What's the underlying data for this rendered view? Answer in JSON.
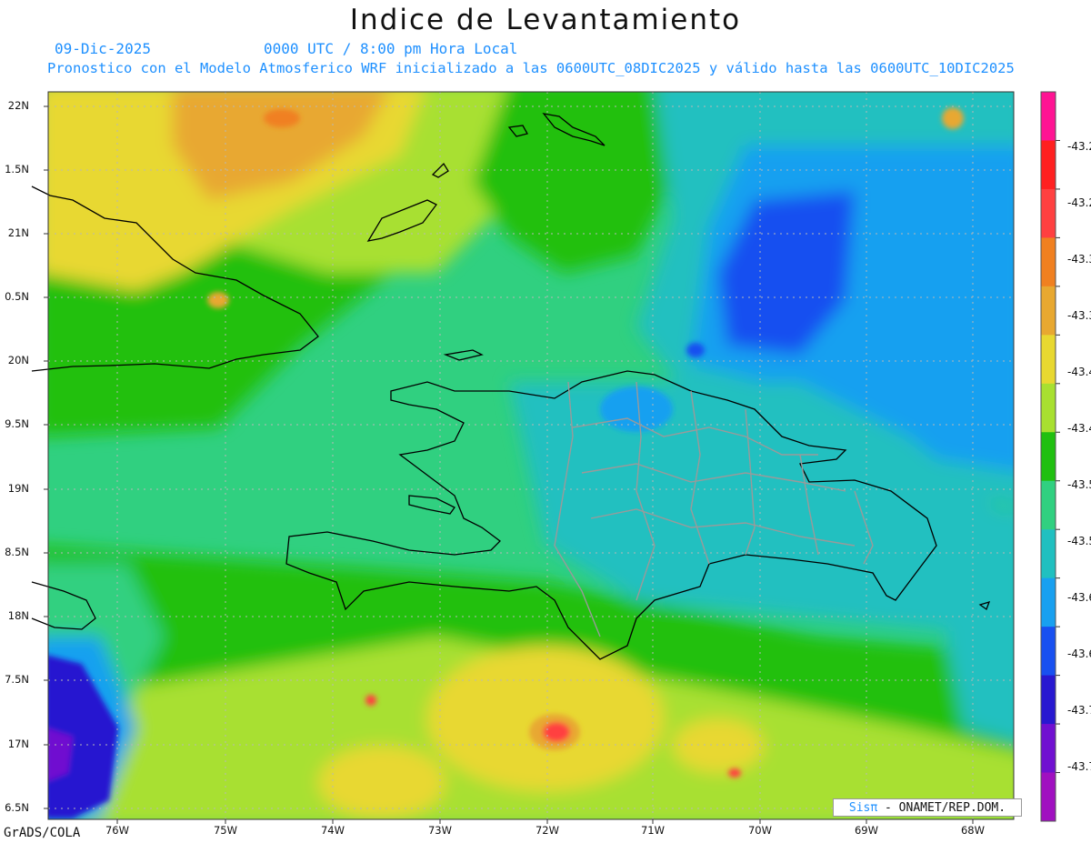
{
  "title": "Indice de Levantamiento",
  "date": "09-Dic-2025",
  "time": "0000 UTC / 8:00 pm Hora Local",
  "model_line": "Pronostico con el Modelo Atmosferico WRF inicializado a las 0600UTC_08DIC2025 y válido hasta las  0600UTC_10DIC2025",
  "lat_labels": [
    "22N",
    "1.5N",
    "21N",
    "0.5N",
    "20N",
    "9.5N",
    "19N",
    "8.5N",
    "18N",
    "7.5N",
    "17N",
    "6.5N"
  ],
  "lon_labels": [
    "76W",
    "75W",
    "74W",
    "73W",
    "72W",
    "71W",
    "70W",
    "69W",
    "68W"
  ],
  "colorbar": {
    "colors": [
      "#ff1493",
      "#ff2020",
      "#ff4040",
      "#f08020",
      "#e8a830",
      "#e8d830",
      "#a8e030",
      "#20c010",
      "#30d080",
      "#20c0c0",
      "#18a0f0",
      "#1850f0",
      "#2818d0",
      "#7010d0",
      "#a010c0"
    ],
    "labels": [
      "-43.2",
      "-43.2",
      "-43.3",
      "-43.3",
      "-43.4",
      "-43.4",
      "-43.5",
      "-43.5",
      "-43.6",
      "-43.6",
      "-43.7",
      "-43.7"
    ]
  },
  "credit_sis": "Sisπ",
  "credit_rest": "- ONAMET/REP.DOM.",
  "software": "GrADS/COLA"
}
